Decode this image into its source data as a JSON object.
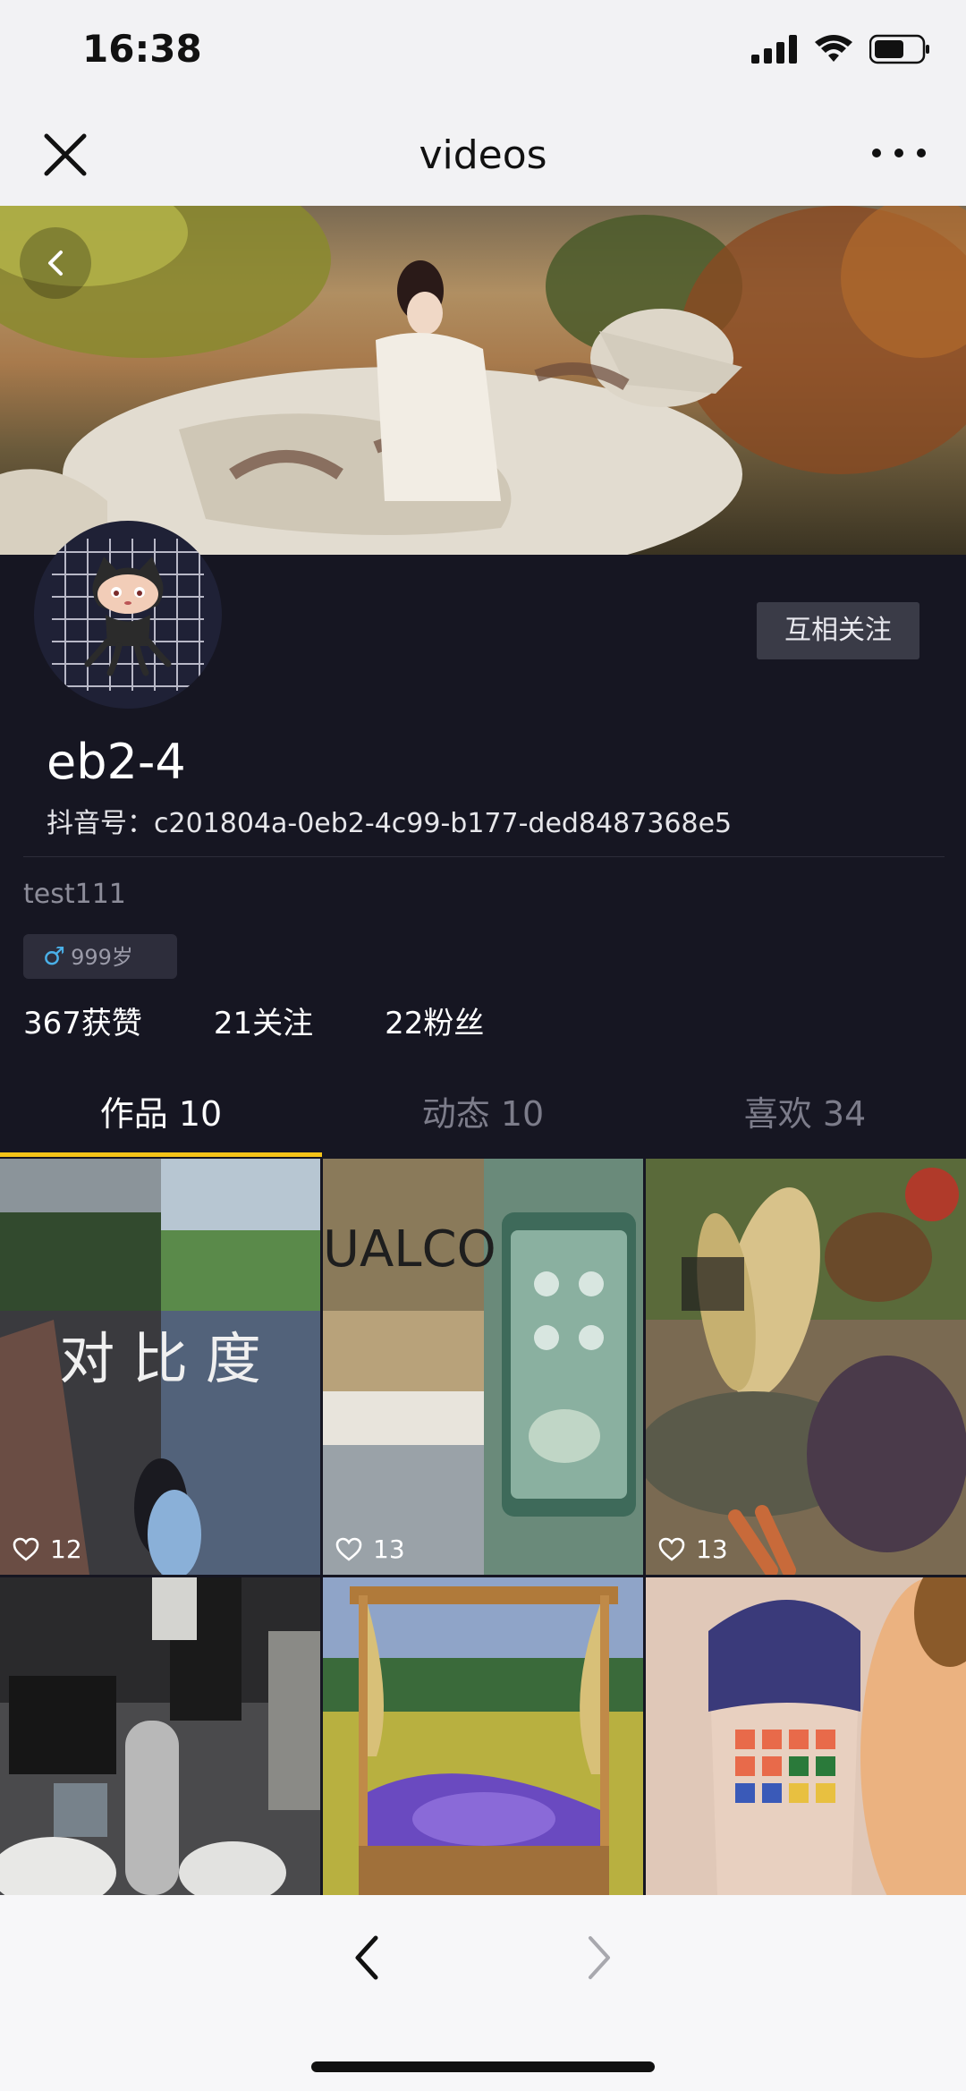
{
  "status_bar": {
    "time": "16:38"
  },
  "nav": {
    "title": "videos"
  },
  "profile": {
    "follow_button": "互相关注",
    "username": "eb2-4",
    "douyin_id": "抖音号：c201804a-0eb2-4c99-b177-ded8487368e5",
    "bio": "test111",
    "age": "999岁",
    "stats": [
      "367获赞",
      "21关注",
      "22粉丝"
    ]
  },
  "tabs": [
    {
      "label": "作品 10",
      "active": true
    },
    {
      "label": "动态 10",
      "active": false
    },
    {
      "label": "喜欢 34",
      "active": false
    }
  ],
  "videos": [
    {
      "likes": "12",
      "overlay_text": "对 比 度"
    },
    {
      "likes": "13",
      "overlay_text": "UALCO"
    },
    {
      "likes": "13",
      "overlay_text": ""
    },
    {
      "likes": ""
    },
    {
      "likes": ""
    },
    {
      "likes": ""
    }
  ],
  "colors": {
    "accent": "#f5c318",
    "profile_bg": "#161622"
  }
}
